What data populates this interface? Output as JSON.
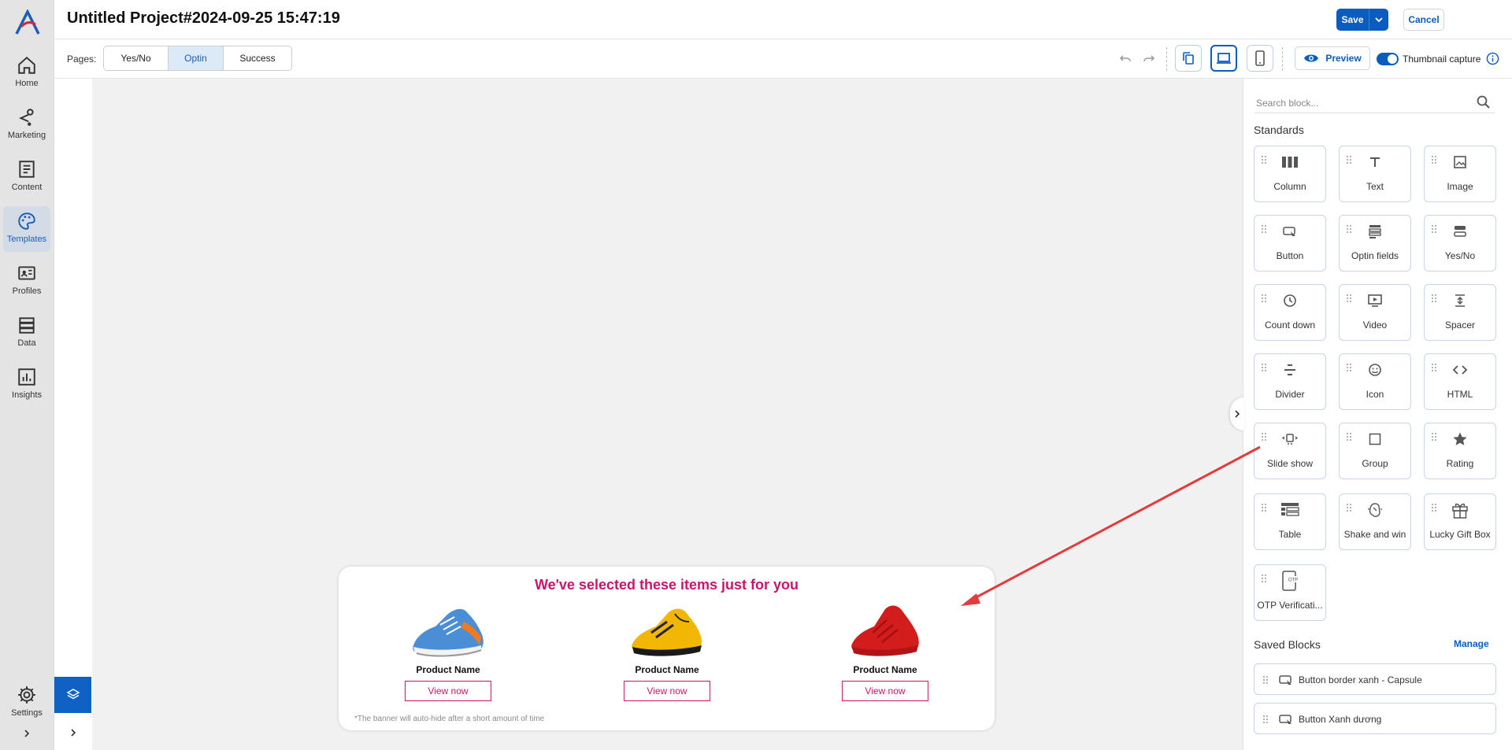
{
  "app": {
    "title": "Untitled Project#2024-09-25 15:47:19",
    "accent_color": "#0b5cc0"
  },
  "nav": {
    "logo": "antsomi-logo",
    "items": [
      {
        "label": "Home",
        "icon": "home-icon"
      },
      {
        "label": "Marketing",
        "icon": "marketing-icon"
      },
      {
        "label": "Content",
        "icon": "content-icon"
      },
      {
        "label": "Templates",
        "icon": "palette-icon",
        "active": true
      },
      {
        "label": "Profiles",
        "icon": "profiles-icon"
      },
      {
        "label": "Data",
        "icon": "data-icon"
      },
      {
        "label": "Insights",
        "icon": "insights-icon"
      }
    ],
    "settings_label": "Settings"
  },
  "header": {
    "save_label": "Save",
    "cancel_label": "Cancel"
  },
  "toolbar": {
    "pages_label": "Pages:",
    "pages": [
      {
        "label": "Yes/No",
        "active": false
      },
      {
        "label": "Optin",
        "active": true
      },
      {
        "label": "Success",
        "active": false
      }
    ],
    "preview_label": "Preview",
    "thumbnail_label": "Thumbnail capture",
    "thumbnail_enabled": true,
    "active_device": "desktop"
  },
  "banner": {
    "title": "We've selected these items just for you",
    "title_color": "#c8156e",
    "products": [
      {
        "name": "Product Name",
        "button": "View now",
        "image": "blue-sneaker"
      },
      {
        "name": "Product Name",
        "button": "View now",
        "image": "yellow-sneaker"
      },
      {
        "name": "Product Name",
        "button": "View now",
        "image": "red-sneaker"
      }
    ],
    "note": "*The banner will auto-hide after a short amount of time"
  },
  "panel": {
    "search_placeholder": "Search block...",
    "standards_title": "Standards",
    "blocks": [
      {
        "label": "Column",
        "icon": "column-icon"
      },
      {
        "label": "Text",
        "icon": "text-icon"
      },
      {
        "label": "Image",
        "icon": "image-icon"
      },
      {
        "label": "Button",
        "icon": "button-icon"
      },
      {
        "label": "Optin fields",
        "icon": "optin-fields-icon"
      },
      {
        "label": "Yes/No",
        "icon": "yes-no-icon"
      },
      {
        "label": "Count down",
        "icon": "clock-icon"
      },
      {
        "label": "Video",
        "icon": "video-icon"
      },
      {
        "label": "Spacer",
        "icon": "spacer-icon"
      },
      {
        "label": "Divider",
        "icon": "divider-icon"
      },
      {
        "label": "Icon",
        "icon": "smiley-icon"
      },
      {
        "label": "HTML",
        "icon": "code-icon"
      },
      {
        "label": "Slide show",
        "icon": "slideshow-icon"
      },
      {
        "label": "Group",
        "icon": "group-icon"
      },
      {
        "label": "Rating",
        "icon": "star-icon"
      },
      {
        "label": "Table",
        "icon": "table-icon"
      },
      {
        "label": "Shake and win",
        "icon": "shake-icon"
      },
      {
        "label": "Lucky Gift Box",
        "icon": "gift-icon"
      },
      {
        "label": "OTP Verificati...",
        "icon": "otp-icon"
      }
    ],
    "saved_title": "Saved Blocks",
    "manage_label": "Manage",
    "saved_blocks": [
      {
        "label": "Button border xanh - Capsule"
      },
      {
        "label": "Button Xanh dương"
      }
    ]
  }
}
